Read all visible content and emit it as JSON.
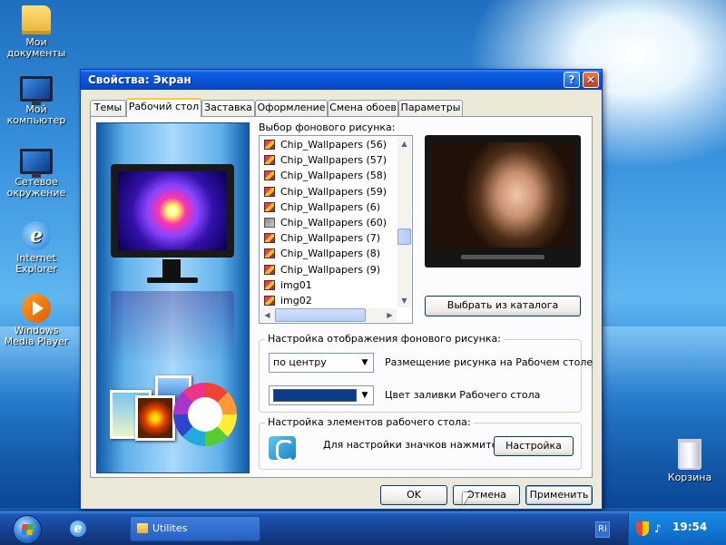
{
  "desktop": {
    "icons": [
      {
        "label": "Мои документы",
        "icon": "folder-icon"
      },
      {
        "label": "Мой компьютер",
        "icon": "computer-icon"
      },
      {
        "label": "Сетевое окружение",
        "icon": "network-icon"
      },
      {
        "label": "Internet Explorer",
        "icon": "ie-icon"
      },
      {
        "label": "Windows Media Player",
        "icon": "media-player-icon"
      },
      {
        "label": "Корзина",
        "icon": "recycle-bin-icon"
      }
    ]
  },
  "dialog": {
    "title": "Свойства: Экран",
    "help_glyph": "?",
    "close_glyph": "✕",
    "tabs": [
      {
        "label": "Темы"
      },
      {
        "label": "Рабочий стол"
      },
      {
        "label": "Заставка"
      },
      {
        "label": "Оформление"
      },
      {
        "label": "Смена обоев"
      },
      {
        "label": "Параметры"
      }
    ],
    "active_tab": "Рабочий стол",
    "background_label": "Выбор фонового рисунка:",
    "wallpapers": [
      "Chip_Wallpapers (56)",
      "Chip_Wallpapers (57)",
      "Chip_Wallpapers (58)",
      "Chip_Wallpapers (59)",
      "Chip_Wallpapers (6)",
      "Chip_Wallpapers (60)",
      "Chip_Wallpapers (7)",
      "Chip_Wallpapers (8)",
      "Chip_Wallpapers (9)",
      "img01",
      "img02"
    ],
    "catalog_button": "Выбрать из каталога",
    "display_group": {
      "title": "Настройка отображения фонового рисунка:",
      "position_value": "по центру",
      "position_label": "Размещение рисунка на Рабочем столе",
      "fill_color": "#0a3d8a",
      "fill_label": "Цвет заливки Рабочего стола"
    },
    "elements_group": {
      "title": "Настройка элементов рабочего стола:",
      "hint": "Для настройки значков нажмите:",
      "button": "Настройка"
    },
    "buttons": {
      "ok": "OK",
      "cancel": "Отмена",
      "apply": "Применить"
    }
  },
  "taskbar": {
    "task_label": "Utilites",
    "language": "RI",
    "clock": "19:54"
  }
}
